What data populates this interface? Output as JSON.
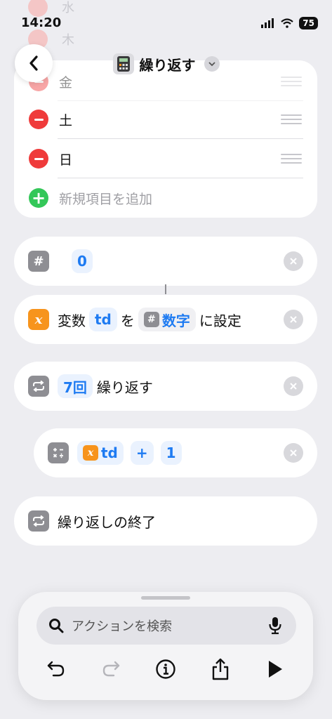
{
  "status": {
    "time": "14:20",
    "battery": "75"
  },
  "header": {
    "title": "繰り返す"
  },
  "list": {
    "items": [
      {
        "label": "金"
      },
      {
        "label": "土"
      },
      {
        "label": "日"
      }
    ],
    "add_label": "新規項目を追加"
  },
  "ghost_rows": [
    "水",
    "木"
  ],
  "actions": {
    "number": {
      "value": "0"
    },
    "set_variable": {
      "prefix": "変数",
      "var_name": "td",
      "particle": "を",
      "input_label": "数字",
      "suffix": "に設定"
    },
    "repeat": {
      "count_label": "7回",
      "text": "繰り返す"
    },
    "calc": {
      "var_name": "td",
      "operator": "+",
      "operand": "1"
    },
    "end_repeat": {
      "text": "繰り返しの終了"
    }
  },
  "search": {
    "placeholder": "アクションを検索"
  },
  "icons": {
    "back": "chevron-left-icon",
    "calculator": "calculator-icon",
    "number": "hash-icon",
    "variable": "variable-x-icon",
    "repeat": "repeat-icon",
    "calculate": "math-operators-icon",
    "search": "search-icon",
    "mic": "mic-icon",
    "undo": "undo-icon",
    "redo": "redo-icon",
    "info": "info-icon",
    "share": "share-icon",
    "play": "play-icon"
  },
  "colors": {
    "accent": "#1E7BF2",
    "delete": "#EF3B3B",
    "add": "#34C759",
    "variable": "#F7941D"
  }
}
